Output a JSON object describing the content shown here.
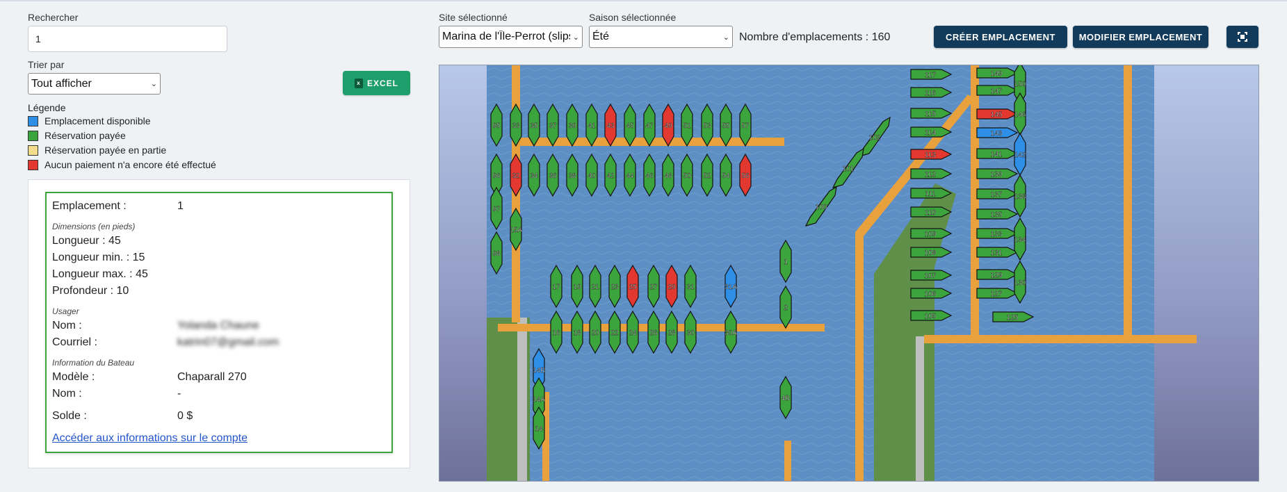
{
  "search": {
    "label": "Rechercher",
    "value": "1"
  },
  "sort": {
    "label": "Trier par",
    "selected": "Tout afficher"
  },
  "excel_button": {
    "label": "EXCEL"
  },
  "legend": {
    "title": "Légende",
    "items": [
      {
        "label": "Emplacement disponible",
        "color": "#2f8ee5"
      },
      {
        "label": "Réservation payée",
        "color": "#3ca43c"
      },
      {
        "label": "Réservation payée en partie",
        "color": "#f3dd8a"
      },
      {
        "label": "Aucun paiement n'a encore été effectué",
        "color": "#e2382f"
      }
    ]
  },
  "details": {
    "slot_label": "Emplacement :",
    "slot_value": "1",
    "dimensions_title": "Dimensions (en pieds)",
    "longueur": "Longueur : 45",
    "longueur_min": "Longueur min. : 15",
    "longueur_max": "Longueur max. : 45",
    "profondeur": "Profondeur : 10",
    "user_title": "Usager",
    "nom_label": "Nom :",
    "nom_value": "Yolanda Chaune",
    "courriel_label": "Courriel :",
    "courriel_value": "katrin07@gmail.com",
    "boat_title": "Information du Bateau",
    "modele_label": "Modèle :",
    "modele_value": "Chaparall 270",
    "bateau_nom_label": "Nom :",
    "bateau_nom_value": "-",
    "solde_label": "Solde :",
    "solde_value": "0 $",
    "account_link": "Accéder aux informations sur le compte"
  },
  "site": {
    "label": "Site sélectionné",
    "selected": "Marina de l'Île-Perrot (slips)"
  },
  "season": {
    "label": "Saison sélectionnée",
    "selected": "Été"
  },
  "slot_count": "Nombre d'emplacements : 160",
  "buttons": {
    "create": "CRÉER EMPLACEMENT",
    "modify": "MODIFIER EMPLACEMENT"
  },
  "colors": {
    "water": "#5d8fc4",
    "dock": "#e8a13c",
    "land": "#5f8f49",
    "available": "#2f8ee5",
    "paid": "#3ca43c",
    "unpaid": "#e2382f"
  },
  "map": {
    "slots": [
      {
        "n": "95",
        "s": "p"
      },
      {
        "n": "33",
        "s": "p"
      },
      {
        "n": "35",
        "s": "p"
      },
      {
        "n": "37",
        "s": "p"
      },
      {
        "n": "39",
        "s": "p"
      },
      {
        "n": "41",
        "s": "p"
      },
      {
        "n": "43",
        "s": "u"
      },
      {
        "n": "45",
        "s": "p"
      },
      {
        "n": "47",
        "s": "p"
      },
      {
        "n": "49",
        "s": "u"
      },
      {
        "n": "51",
        "s": "p"
      },
      {
        "n": "53",
        "s": "p"
      },
      {
        "n": "55",
        "s": "p"
      },
      {
        "n": "57",
        "s": "p"
      },
      {
        "n": "96",
        "s": "p"
      },
      {
        "n": "32",
        "s": "u"
      },
      {
        "n": "34",
        "s": "p"
      },
      {
        "n": "36",
        "s": "p"
      },
      {
        "n": "38",
        "s": "p"
      },
      {
        "n": "40",
        "s": "p"
      },
      {
        "n": "42",
        "s": "p"
      },
      {
        "n": "44",
        "s": "p"
      },
      {
        "n": "46",
        "s": "p"
      },
      {
        "n": "48",
        "s": "p"
      },
      {
        "n": "50",
        "s": "p"
      },
      {
        "n": "52",
        "s": "p"
      },
      {
        "n": "54",
        "s": "p"
      },
      {
        "n": "56",
        "s": "u"
      },
      {
        "n": "97",
        "s": "p"
      },
      {
        "n": "15A",
        "s": "p"
      },
      {
        "n": "98",
        "s": "p"
      },
      {
        "n": "17",
        "s": "p"
      },
      {
        "n": "19",
        "s": "p"
      },
      {
        "n": "21",
        "s": "p"
      },
      {
        "n": "23",
        "s": "p"
      },
      {
        "n": "25",
        "s": "u"
      },
      {
        "n": "27",
        "s": "p"
      },
      {
        "n": "29",
        "s": "u"
      },
      {
        "n": "31",
        "s": "p"
      },
      {
        "n": "31A",
        "s": "a"
      },
      {
        "n": "16",
        "s": "p"
      },
      {
        "n": "18",
        "s": "p"
      },
      {
        "n": "20",
        "s": "p"
      },
      {
        "n": "22",
        "s": "p"
      },
      {
        "n": "24",
        "s": "p"
      },
      {
        "n": "26",
        "s": "p"
      },
      {
        "n": "28",
        "s": "p"
      },
      {
        "n": "30",
        "s": "p"
      },
      {
        "n": "30A",
        "s": "p"
      },
      {
        "n": "14B",
        "s": "a"
      },
      {
        "n": "14A",
        "s": "p"
      },
      {
        "n": "14",
        "s": "p"
      },
      {
        "n": "102",
        "s": "p"
      },
      {
        "n": "101",
        "s": "p"
      },
      {
        "n": "100",
        "s": "p"
      },
      {
        "n": "1",
        "s": "p"
      },
      {
        "n": "2",
        "s": "p"
      },
      {
        "n": "4B",
        "s": "p"
      },
      {
        "n": "117",
        "s": "p"
      },
      {
        "n": "116",
        "s": "p"
      },
      {
        "n": "115",
        "s": "p"
      },
      {
        "n": "114",
        "s": "p"
      },
      {
        "n": "113",
        "s": "u"
      },
      {
        "n": "112",
        "s": "p"
      },
      {
        "n": "111",
        "s": "p"
      },
      {
        "n": "110",
        "s": "p"
      },
      {
        "n": "109",
        "s": "p"
      },
      {
        "n": "108",
        "s": "p"
      },
      {
        "n": "107",
        "s": "p"
      },
      {
        "n": "106",
        "s": "p"
      },
      {
        "n": "105",
        "s": "p"
      },
      {
        "n": "149",
        "s": "p"
      },
      {
        "n": "147",
        "s": "p"
      },
      {
        "n": "145",
        "s": "u"
      },
      {
        "n": "143",
        "s": "a"
      },
      {
        "n": "141",
        "s": "p"
      },
      {
        "n": "139",
        "s": "p"
      },
      {
        "n": "137",
        "s": "p"
      },
      {
        "n": "135",
        "s": "p"
      },
      {
        "n": "133",
        "s": "p"
      },
      {
        "n": "131",
        "s": "p"
      },
      {
        "n": "129",
        "s": "p"
      },
      {
        "n": "127",
        "s": "p"
      },
      {
        "n": "125",
        "s": "p"
      },
      {
        "n": "150",
        "s": "p"
      },
      {
        "n": "146",
        "s": "p"
      },
      {
        "n": "142",
        "s": "a"
      },
      {
        "n": "138",
        "s": "p"
      },
      {
        "n": "134",
        "s": "p"
      },
      {
        "n": "130",
        "s": "p"
      }
    ]
  }
}
